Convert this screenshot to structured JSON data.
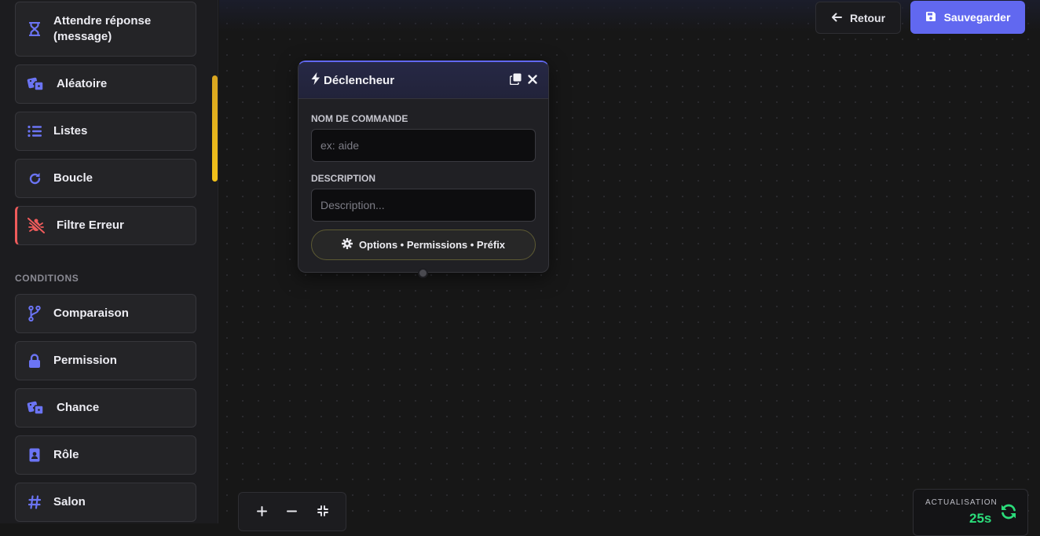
{
  "sidebar": {
    "items_top": [
      {
        "label": "Attendre réponse (message)",
        "icon": "hourglass-icon"
      },
      {
        "label": "Aléatoire",
        "icon": "dice-icon"
      },
      {
        "label": "Listes",
        "icon": "list-icon"
      },
      {
        "label": "Boucle",
        "icon": "loop-icon"
      },
      {
        "label": "Filtre Erreur",
        "icon": "bug-slash-icon"
      }
    ],
    "conditions_title": "CONDITIONS",
    "items_conditions": [
      {
        "label": "Comparaison",
        "icon": "code-branch-icon"
      },
      {
        "label": "Permission",
        "icon": "lock-icon"
      },
      {
        "label": "Chance",
        "icon": "dice-icon"
      },
      {
        "label": "Rôle",
        "icon": "id-badge-icon"
      },
      {
        "label": "Salon",
        "icon": "hashtag-icon"
      }
    ]
  },
  "toolbar": {
    "back_label": "Retour",
    "save_label": "Sauvegarder"
  },
  "node": {
    "title": "Déclencheur",
    "command_name_label": "NOM DE COMMANDE",
    "command_name_placeholder": "ex: aide",
    "command_name_value": "",
    "description_label": "DESCRIPTION",
    "description_placeholder": "Description...",
    "description_value": "",
    "options_label": "Options • Permissions • Préfix"
  },
  "zoom": {
    "zoom_in": "+",
    "zoom_out": "−"
  },
  "refresh": {
    "label": "ACTUALISATION",
    "value": "25s"
  },
  "colors": {
    "accent": "#6168f0",
    "icon_blue": "#6b74f4",
    "error": "#ef5b5b",
    "refresh_green": "#2bdc7a",
    "scrollbar": "#f2c21a"
  }
}
